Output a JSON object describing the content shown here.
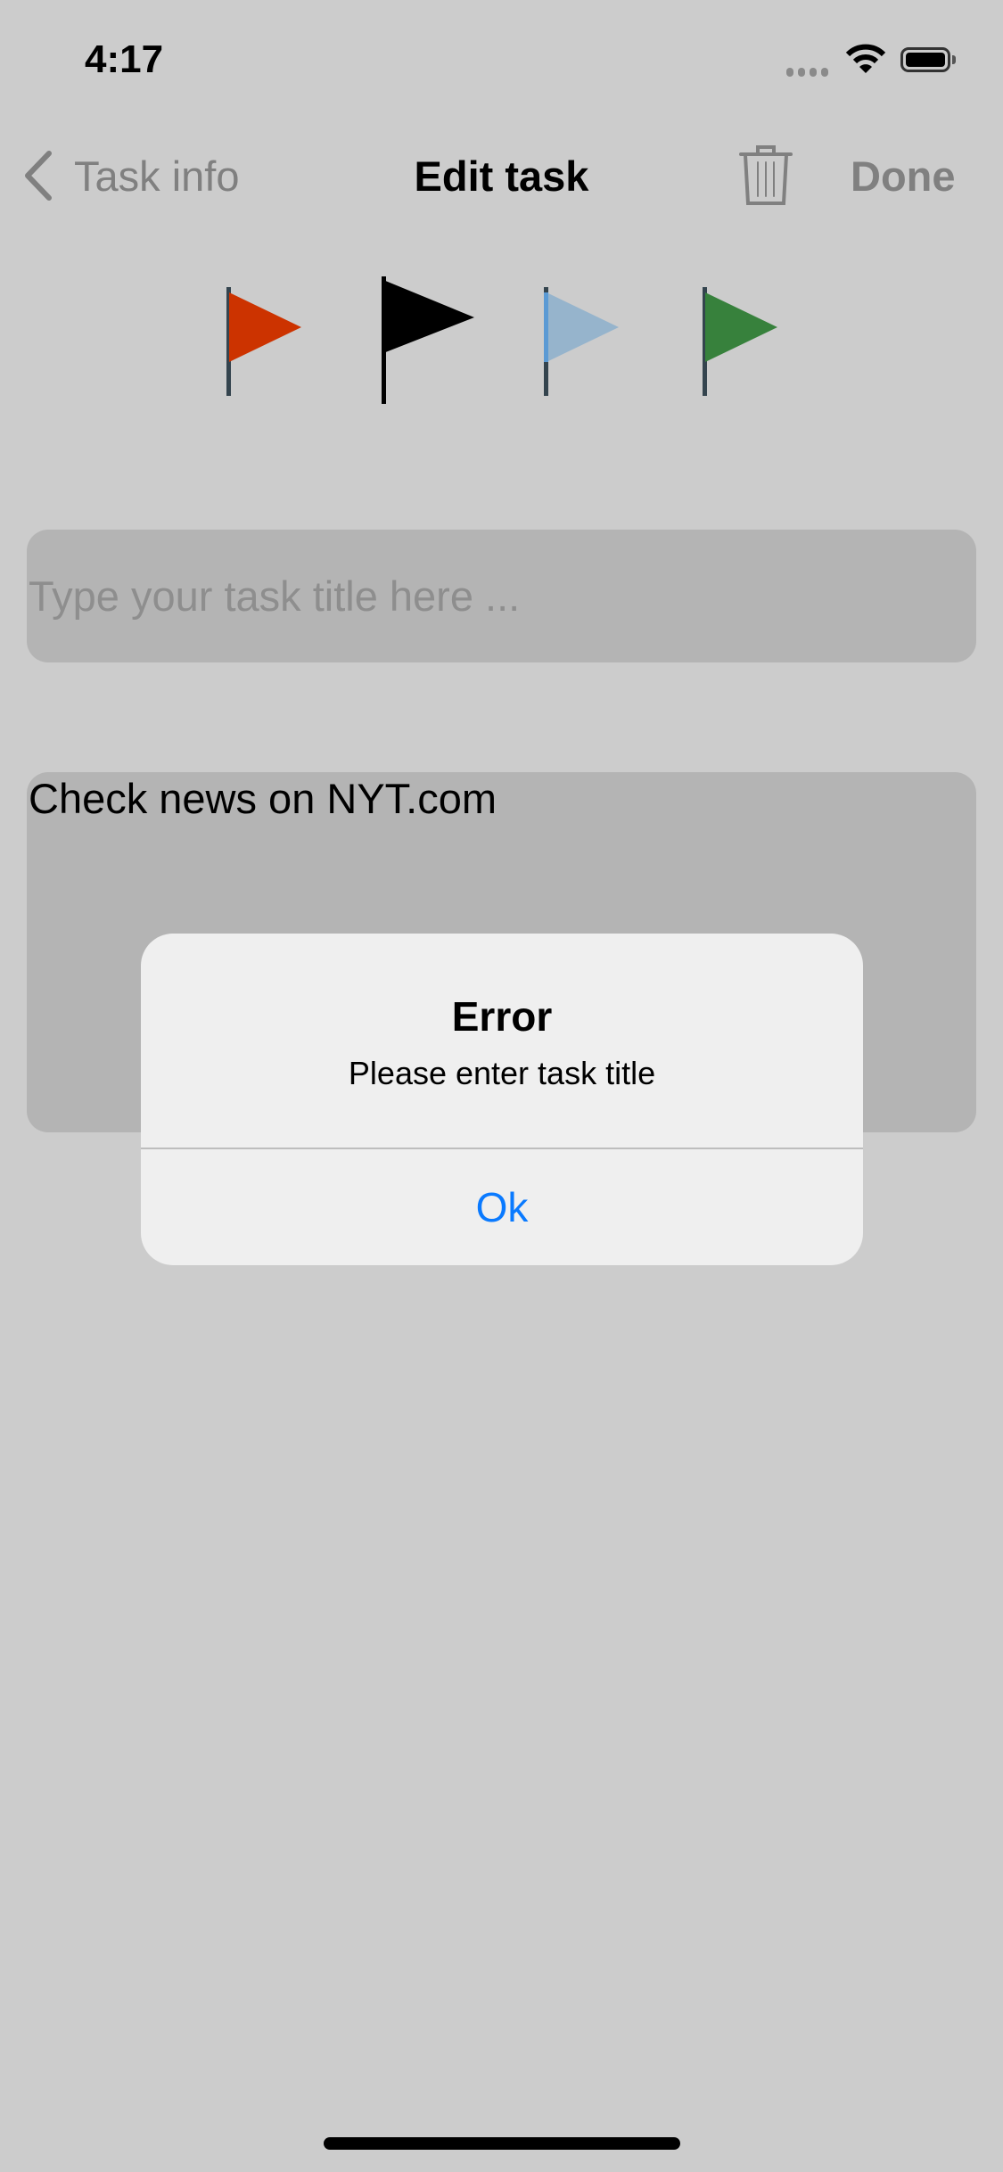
{
  "status_bar": {
    "time": "4:17"
  },
  "nav": {
    "back_label": "Task info",
    "title": "Edit task",
    "done_label": "Done"
  },
  "flags": [
    {
      "name": "red",
      "color": "#cc3300"
    },
    {
      "name": "black",
      "color": "#000000",
      "selected": true
    },
    {
      "name": "light-blue",
      "color": "#96b4cc"
    },
    {
      "name": "green",
      "color": "#37813c"
    }
  ],
  "form": {
    "title_placeholder": "Type your task title here ...",
    "title_value": "",
    "notes_value": "Check news on NYT.com"
  },
  "alert": {
    "title": "Error",
    "message": "Please enter task title",
    "ok_label": "Ok",
    "accent": "#0a7aff"
  }
}
